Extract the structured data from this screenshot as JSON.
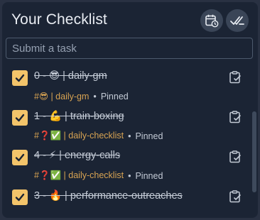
{
  "header": {
    "title": "Your Checklist"
  },
  "input": {
    "placeholder": "Submit a task"
  },
  "tasks": [
    {
      "title": "0 - 😎 | daily-gm",
      "tag": "#😎 | daily-gm",
      "status": "Pinned"
    },
    {
      "title": "1 - 💪 | train-boxing",
      "tag": "#❓✅ | daily-checklist",
      "status": "Pinned"
    },
    {
      "title": "4 - ⚡ | energy-calls",
      "tag": "#❓✅ | daily-checklist",
      "status": "Pinned"
    },
    {
      "title": "3 - 🔥 | performance-outreaches",
      "tag": "",
      "status": ""
    }
  ],
  "colors": {
    "accent": "#f3c46a",
    "tag": "#d8a352",
    "panel": "#1b2434",
    "frame": "#293142"
  },
  "icons": [
    "calendar-icon",
    "double-check-icon",
    "checkbox-icon",
    "clipboard-check-icon"
  ]
}
